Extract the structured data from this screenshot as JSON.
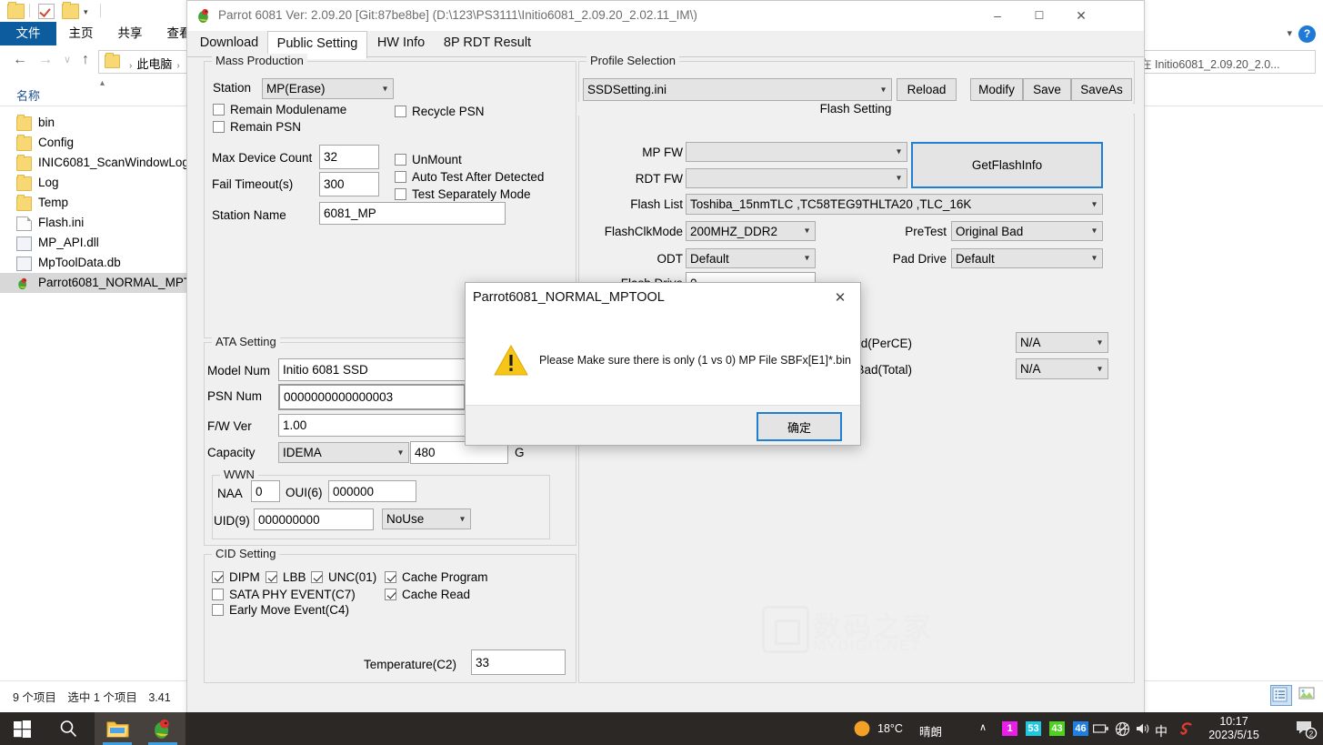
{
  "explorer": {
    "quick_access": {
      "icons": [
        "folder-icon",
        "checkbox-icon",
        "folder-icon",
        "dropdown-arrow-icon"
      ]
    },
    "ribbon_tabs": [
      {
        "label": "文件",
        "active": true
      },
      {
        "label": "主页",
        "active": false
      },
      {
        "label": "共享",
        "active": false
      },
      {
        "label": "查看",
        "active": false
      }
    ],
    "help_label": "?",
    "nav": {
      "back": "←",
      "forward": "→",
      "recent": "∨",
      "up": "↑"
    },
    "breadcrumb": [
      "此电脑"
    ],
    "search_value": "在 Initio6081_2.09.20_2.0...",
    "column_header": "名称",
    "files": [
      {
        "name": "bin",
        "type": "folder",
        "selected": false
      },
      {
        "name": "Config",
        "type": "folder",
        "selected": false
      },
      {
        "name": "INIC6081_ScanWindowLog",
        "type": "folder",
        "selected": false
      },
      {
        "name": "Log",
        "type": "folder",
        "selected": false
      },
      {
        "name": "Temp",
        "type": "folder",
        "selected": false
      },
      {
        "name": "Flash.ini",
        "type": "ini",
        "selected": false
      },
      {
        "name": "MP_API.dll",
        "type": "dll",
        "selected": false
      },
      {
        "name": "MpToolData.db",
        "type": "dll",
        "selected": false
      },
      {
        "name": "Parrot6081_NORMAL_MPT",
        "type": "app",
        "selected": true
      }
    ],
    "status": "9 个项目　选中 1 个项目　3.41",
    "view_modes": [
      "list-view-icon",
      "tile-view-icon"
    ]
  },
  "app": {
    "title": "Parrot 6081 Ver: 2.09.20 [Git:87be8be] (D:\\123\\PS3111\\Initio6081_2.09.20_2.02.11_IM\\)",
    "window_buttons": {
      "minimize": "–",
      "maximize": "☐",
      "close": "✕"
    },
    "tabs": [
      {
        "label": "Download",
        "active": false
      },
      {
        "label": "Public Setting",
        "active": true
      },
      {
        "label": "HW Info",
        "active": false
      },
      {
        "label": "8P RDT Result",
        "active": false
      }
    ],
    "mass_production": {
      "title": "Mass Production",
      "station_label": "Station",
      "station_value": "MP(Erase)",
      "checkboxes": [
        {
          "label": "Remain Modulename",
          "checked": false
        },
        {
          "label": "Remain PSN",
          "checked": false
        },
        {
          "label": "Recycle PSN",
          "checked": false
        },
        {
          "label": "UnMount",
          "checked": false
        },
        {
          "label": "Auto Test After Detected",
          "checked": false
        },
        {
          "label": "Test Separately Mode",
          "checked": false
        }
      ],
      "max_device_count_label": "Max Device Count",
      "max_device_count_value": "32",
      "fail_timeout_label": "Fail Timeout(s)",
      "fail_timeout_value": "300",
      "station_name_label": "Station Name",
      "station_name_value": "6081_MP"
    },
    "ata_setting": {
      "title": "ATA Setting",
      "model_num_label": "Model Num",
      "model_num_value": "Initio 6081 SSD",
      "psn_num_label": "PSN Num",
      "psn_num_value": "0000000000000003",
      "fw_ver_label": "F/W Ver",
      "fw_ver_value": "1.00",
      "capacity_label": "Capacity",
      "capacity_mode": "IDEMA",
      "capacity_value": "480",
      "capacity_unit": "G",
      "wwn_title": "WWN",
      "naa_label": "NAA",
      "naa_value": "0",
      "oui_label": "OUI(6)",
      "oui_value": "000000",
      "uid_label": "UID(9)",
      "uid_value": "000000000",
      "uid_mode": "NoUse"
    },
    "cid_setting": {
      "title": "CID Setting",
      "checkboxes": [
        {
          "label": "DIPM",
          "checked": true
        },
        {
          "label": "LBB",
          "checked": true
        },
        {
          "label": "UNC(01)",
          "checked": true
        },
        {
          "label": "Cache Program",
          "checked": true
        },
        {
          "label": "SATA PHY EVENT(C7)",
          "checked": false
        },
        {
          "label": "Cache Read",
          "checked": true
        },
        {
          "label": "Early Move Event(C4)",
          "checked": false
        }
      ],
      "temperature_label": "Temperature(C2)",
      "temperature_value": "33"
    },
    "profile_selection": {
      "title": "Profile Selection",
      "profile_value": "SSDSetting.ini",
      "reload_label": "Reload",
      "modify_label": "Modify",
      "save_label": "Save",
      "saveas_label": "SaveAs"
    },
    "flash_setting": {
      "title": "Flash Setting",
      "mp_fw_label": "MP FW",
      "mp_fw_value": "",
      "rdt_fw_label": "RDT FW",
      "rdt_fw_value": "",
      "get_flash_info_label": "GetFlashInfo",
      "flash_list_label": "Flash List",
      "flash_list_value": "Toshiba_15nmTLC ,TC58TEG9THLTA20           ,TLC_16K",
      "flash_clk_mode_label": "FlashClkMode",
      "flash_clk_mode_value": "200MHZ_DDR2",
      "pretest_label": "PreTest",
      "pretest_value": "Original Bad",
      "odt_label": "ODT",
      "odt_value": "Default",
      "pad_drive_label": "Pad Drive",
      "pad_drive_value": "Default",
      "flash_drive_label": "Flash Drive",
      "flash_drive_value": "0",
      "later_bad_perce_label": "LaterBad(PerCE)",
      "later_bad_perce_value": "N/A",
      "later_bad_total_label": "LaterBad(Total)",
      "later_bad_total_value": "N/A"
    },
    "watermark": {
      "cn": "数码之家",
      "en": "MYDIGIT.NET"
    }
  },
  "dialog": {
    "title": "Parrot6081_NORMAL_MPTOOL",
    "close_label": "✕",
    "icon": "warning-icon",
    "message": "Please Make sure there is only (1 vs 0) MP File SBFx[E1]*.bin",
    "ok_label": "确定"
  },
  "taskbar": {
    "start_icon": "windows-start-icon",
    "search_icon": "search-icon",
    "pinned": [
      {
        "name": "file-explorer-icon"
      },
      {
        "name": "parrot-mptool-icon"
      }
    ],
    "weather": {
      "icon": "sun-icon",
      "temp": "18°C",
      "condition": "晴朗"
    },
    "tray_chevron": "∧",
    "tray_badges": [
      {
        "label": "1",
        "color": "#e91ee9"
      },
      {
        "label": "53",
        "color": "#1fc8e0"
      },
      {
        "label": "43",
        "color": "#4cd21f"
      },
      {
        "label": "46",
        "color": "#1f7fe0"
      }
    ],
    "tray_icons": [
      "battery-icon",
      "network-icon",
      "volume-icon",
      "ime-icon",
      "sogou-icon"
    ],
    "ime_label": "中",
    "clock_time": "10:17",
    "clock_date": "2023/5/15",
    "notification_count": "2"
  },
  "colors": {
    "accent_blue": "#1f7fd0",
    "taskbar_bg": "#2b2825",
    "window_bg": "#f0f0f0",
    "warning_yellow": "#f5c518",
    "ribbon_file": "#0d5c9e"
  }
}
